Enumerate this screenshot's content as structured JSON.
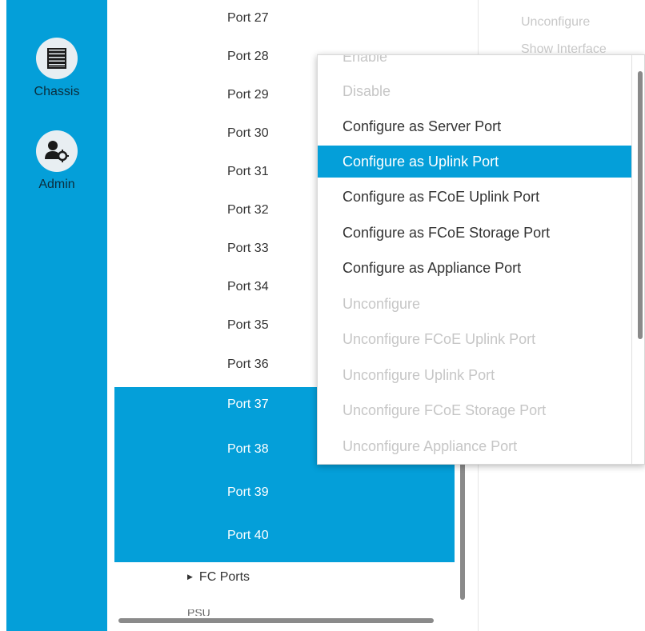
{
  "nav": {
    "items": [
      {
        "label": "Chassis",
        "icon": "chassis-icon"
      },
      {
        "label": "Admin",
        "icon": "admin-icon"
      }
    ]
  },
  "tree": {
    "ports": [
      {
        "label": "Port 27",
        "selected": false
      },
      {
        "label": "Port 28",
        "selected": false
      },
      {
        "label": "Port 29",
        "selected": false
      },
      {
        "label": "Port 30",
        "selected": false
      },
      {
        "label": "Port 31",
        "selected": false
      },
      {
        "label": "Port 32",
        "selected": false
      },
      {
        "label": "Port 33",
        "selected": false
      },
      {
        "label": "Port 34",
        "selected": false
      },
      {
        "label": "Port 35",
        "selected": false
      },
      {
        "label": "Port 36",
        "selected": false
      },
      {
        "label": "Port 37",
        "selected": true
      },
      {
        "label": "Port 38",
        "selected": true
      },
      {
        "label": "Port 39",
        "selected": true
      },
      {
        "label": "Port 40",
        "selected": true
      }
    ],
    "fc_ports": "FC Ports",
    "psu": "PSU"
  },
  "right_panel": {
    "unconfigure": "Unconfigure",
    "show_interface": "Show Interface"
  },
  "context_menu": {
    "items": [
      {
        "label": "Enable",
        "state": "disabled"
      },
      {
        "label": "Disable",
        "state": "disabled"
      },
      {
        "label": "Configure as Server Port",
        "state": "enabled"
      },
      {
        "label": "Configure as Uplink Port",
        "state": "highlighted"
      },
      {
        "label": "Configure as FCoE Uplink Port",
        "state": "enabled"
      },
      {
        "label": "Configure as FCoE Storage Port",
        "state": "enabled"
      },
      {
        "label": "Configure as Appliance Port",
        "state": "enabled"
      },
      {
        "label": "Unconfigure",
        "state": "disabled"
      },
      {
        "label": "Unconfigure FCoE Uplink Port",
        "state": "disabled"
      },
      {
        "label": "Unconfigure Uplink Port",
        "state": "disabled"
      },
      {
        "label": "Unconfigure FCoE Storage Port",
        "state": "disabled"
      },
      {
        "label": "Unconfigure Appliance Port",
        "state": "disabled"
      }
    ]
  },
  "colors": {
    "accent": "#049fd9",
    "disabled_text": "#c6c6c6"
  }
}
